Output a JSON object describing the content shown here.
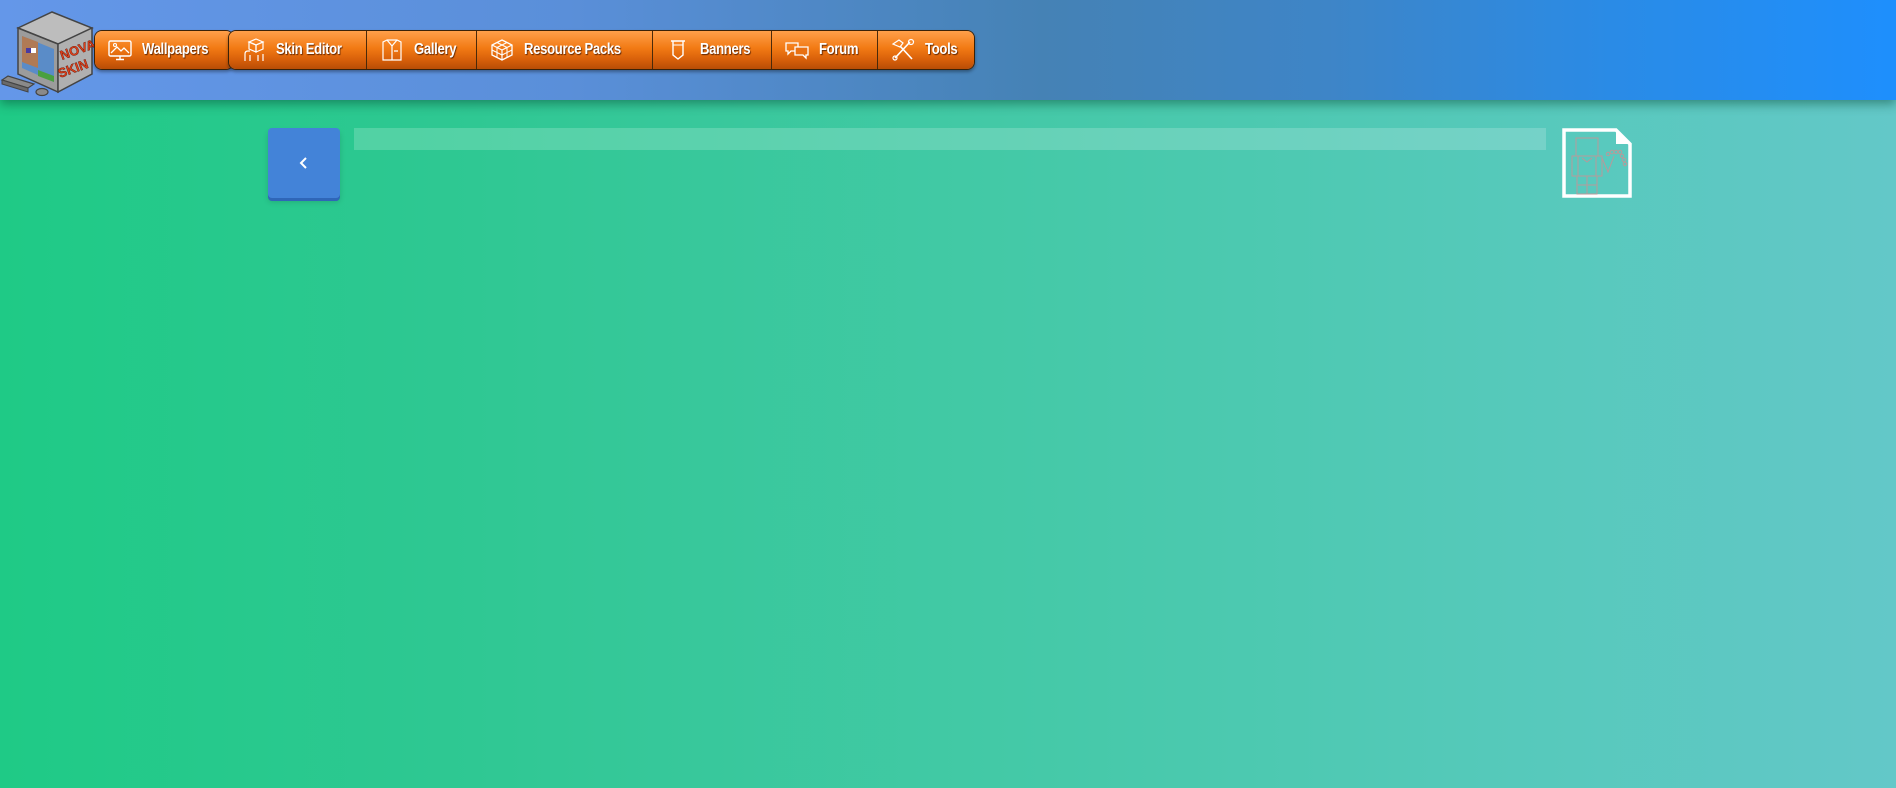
{
  "header": {
    "logo": {
      "line1": "NOVA",
      "line2": "SKIN",
      "icon": "nova-skin-computer-logo"
    },
    "nav_groups": [
      {
        "items": [
          {
            "label": "Wallpapers",
            "icon": "monitor-image-icon"
          }
        ]
      },
      {
        "items": [
          {
            "label": "Skin Editor",
            "icon": "character-cube-icon"
          },
          {
            "label": "Gallery",
            "icon": "shirt-icon"
          },
          {
            "label": "Resource Packs",
            "icon": "cube-grid-icon"
          },
          {
            "label": "Banners",
            "icon": "banner-shield-icon"
          },
          {
            "label": "Forum",
            "icon": "chat-bubbles-icon"
          },
          {
            "label": "Tools",
            "icon": "hammer-wrench-icon"
          }
        ]
      }
    ]
  },
  "main": {
    "back_button": {
      "glyph": "‹",
      "icon": "chevron-left-icon"
    },
    "title": "",
    "document_icon": "skin-template-document-icon"
  },
  "colors": {
    "nav_orange": "#f27a14",
    "back_button_blue": "#4383d8",
    "header_blue_right": "#1e8ffd",
    "body_green_left": "#1fca86",
    "body_teal_right": "#63c8c8"
  }
}
